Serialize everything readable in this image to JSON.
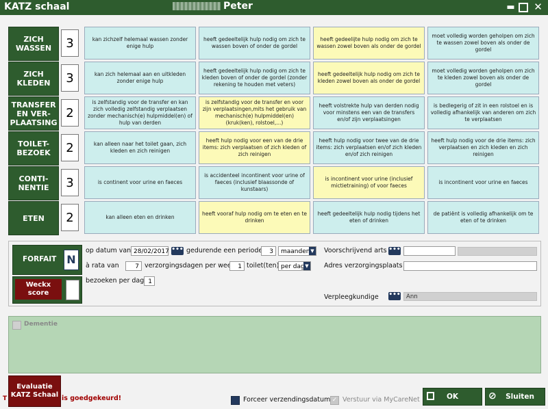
{
  "window": {
    "title": "KATZ schaal",
    "patient_name": "Peter"
  },
  "rows": [
    {
      "category": "ZICH WASSEN",
      "score": "3",
      "cells": [
        "kan zichzelf helemaal wassen zonder enige hulp",
        "heeft gedeeltelijk hulp nodig om zich te wassen boven of onder de gordel",
        "heeft gedeelijte hulp nodig om zich te wassen zowel boven als onder de gordel",
        "moet volledig worden geholpen om zich te wassen zowel boven als onder de gordel"
      ]
    },
    {
      "category": "ZICH KLEDEN",
      "score": "3",
      "cells": [
        "kan zich helemaal aan en uitkleden zonder enige hulp",
        "heeft gedeeltelijk hulp nodig om zich te kleden boven of onder de gordel (zonder rekening te houden met veters)",
        "heeft gedeeltelijk hulp nodig om zich te kleden zowel boven als onder de gordel",
        "moet volledig worden geholpen om zich te kleden zowel boven als onder de gordel"
      ]
    },
    {
      "category": "TRANSFER EN VER-PLAATSING",
      "score": "2",
      "cells": [
        "is zelfstandig voor de transfer en kan zich volledig zelfstandig verplaatsen zonder mechanisch(e) hulpmiddel(en) of hulp van derden",
        "is zelfstandig voor de transfer en voor zijn verplaatsingen,mits het gebruik van mechanisch(e) hulpmiddel(en) (kruk(ken), rolstoel,...)",
        "heeft volstrekte hulp van derden nodig voor minstens een van de transfers en/of zijn verplaatsingen",
        "is bedlegerig of zit in een rolstoel en is volledig afhankelijk van anderen om zich te verplaatsen"
      ]
    },
    {
      "category": "TOILET-BEZOEK",
      "score": "2",
      "cells": [
        "kan alleen naar het toilet gaan, zich kleden en zich reinigen",
        "heeft hulp nodig voor een van de drie items: zich verplaatsen of zich kleden of zich reinigen",
        "heeft hulp nodig voor twee van de drie items: zich verplaatsen en/of zich kleden en/of zich reinigen",
        "heeft hulp nodig voor de drie items: zich verplaatsen en zich kleden en zich reinigen"
      ]
    },
    {
      "category": "CONTI-NENTIE",
      "score": "3",
      "cells": [
        "is continent voor urine en faeces",
        "is accidenteel incontinent voor urine of faeces (inclusief blaassonde of kunstaars)",
        "is incontinent voor urine (inclusief mictietraining) of voor faeces",
        "is incontinent voor urine en faeces"
      ]
    },
    {
      "category": "ETEN",
      "score": "2",
      "cells": [
        "kan alleen eten en drinken",
        "heeft vooraf hulp nodig om te eten en te drinken",
        "heeft gedeeltelijk hulp nodig tijdens het eten of drinken",
        "de patiënt is volledig afhankelijk om te eten of te drinken"
      ]
    }
  ],
  "forfait": {
    "label": "FORFAIT",
    "value": "N",
    "weckx_label": "Weckx score",
    "weckx_value": "",
    "op_datum_label": "op datum van",
    "date": "28/02/2017",
    "dots": "•••",
    "periode_label": "gedurende een periode",
    "periode_value": "3",
    "periode_unit": "maanden",
    "rata_label": "à rata van",
    "rata_value": "7",
    "verzorging_label": "verzorgingsdagen per week",
    "toilet_value": "1",
    "toilet_label": "toilet(ten)",
    "toilet_unit": "per dag",
    "bezoeken_label": "bezoeken per dag",
    "bezoeken_value": "1",
    "arts_label": "Voorschrijvend arts",
    "adres_label": "Adres verzorgingsplaats",
    "verpleeg_label": "Verpleegkundige",
    "verpleeg_value": "Ann"
  },
  "dementie": {
    "label": "Dementie"
  },
  "footer": {
    "evaluatie_label": "Evaluatie KATZ Schaal",
    "status_prefix": "T",
    "status_text": "is goedgekeurd!",
    "forceer_label": "Forceer verzendingsdatum",
    "verstuur_label": "Verstuur via MyCareNet",
    "ok_label": "OK",
    "sluiten_label": "Sluiten"
  },
  "colors": {
    "green": "#2e5c2e",
    "teal": "#cdeeed",
    "yellow": "#fcfab8",
    "maroon": "#7a0f0f",
    "navy": "#23395d"
  }
}
